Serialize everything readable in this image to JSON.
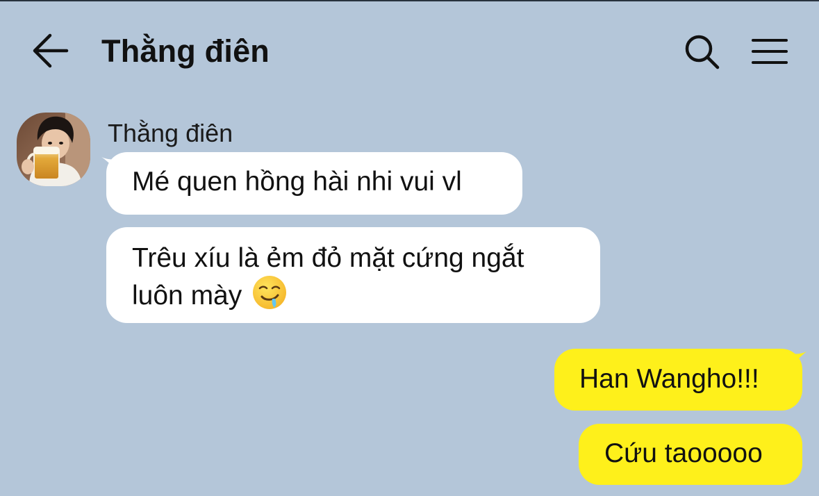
{
  "header": {
    "title": "Thằng điên",
    "back_icon": "arrow-left-icon",
    "search_icon": "search-icon",
    "menu_icon": "hamburger-menu-icon"
  },
  "colors": {
    "background": "#b4c6d9",
    "incoming_bubble": "#ffffff",
    "outgoing_bubble": "#fef01b",
    "text": "#111111"
  },
  "messages": {
    "sender_name": "Thằng điên",
    "incoming": [
      {
        "text": "Mé quen hồng hài nhi vui vl"
      },
      {
        "line1": "Trêu xíu là ẻm đỏ mặt cứng ngắt",
        "line2": "luôn mày",
        "emoji": "drooling-face-emoji"
      }
    ],
    "outgoing": [
      {
        "text": "Han Wangho!!!"
      },
      {
        "text": "Cứu taooooo"
      }
    ]
  }
}
